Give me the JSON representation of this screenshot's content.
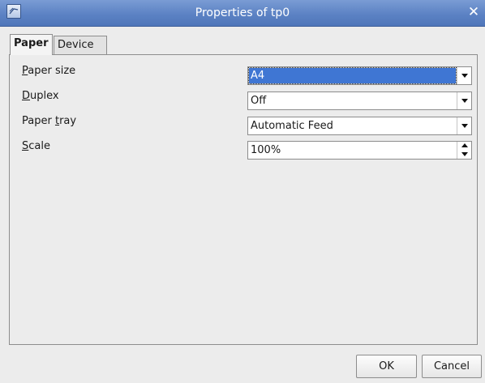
{
  "window": {
    "title": "Properties of tp0",
    "close_glyph": "✕",
    "app_icon": "printer-dialog-icon"
  },
  "tabs": [
    {
      "label": "Paper",
      "active": true
    },
    {
      "label": "Device",
      "active": false
    }
  ],
  "fields": {
    "paper_size": {
      "label_mnemonic": "P",
      "label_rest": "aper size",
      "value": "A4"
    },
    "duplex": {
      "label_mnemonic": "D",
      "label_rest": "uplex",
      "value": "Off"
    },
    "paper_tray": {
      "label_pre": "Paper ",
      "label_mnemonic": "t",
      "label_rest": "ray",
      "value": "Automatic Feed"
    },
    "scale": {
      "label_mnemonic": "S",
      "label_rest": "cale",
      "value": "100%"
    }
  },
  "buttons": {
    "ok": "OK",
    "cancel": "Cancel"
  },
  "colors": {
    "titlebar": "#5c82c4",
    "selection": "#3f76d3",
    "background": "#ececec"
  }
}
